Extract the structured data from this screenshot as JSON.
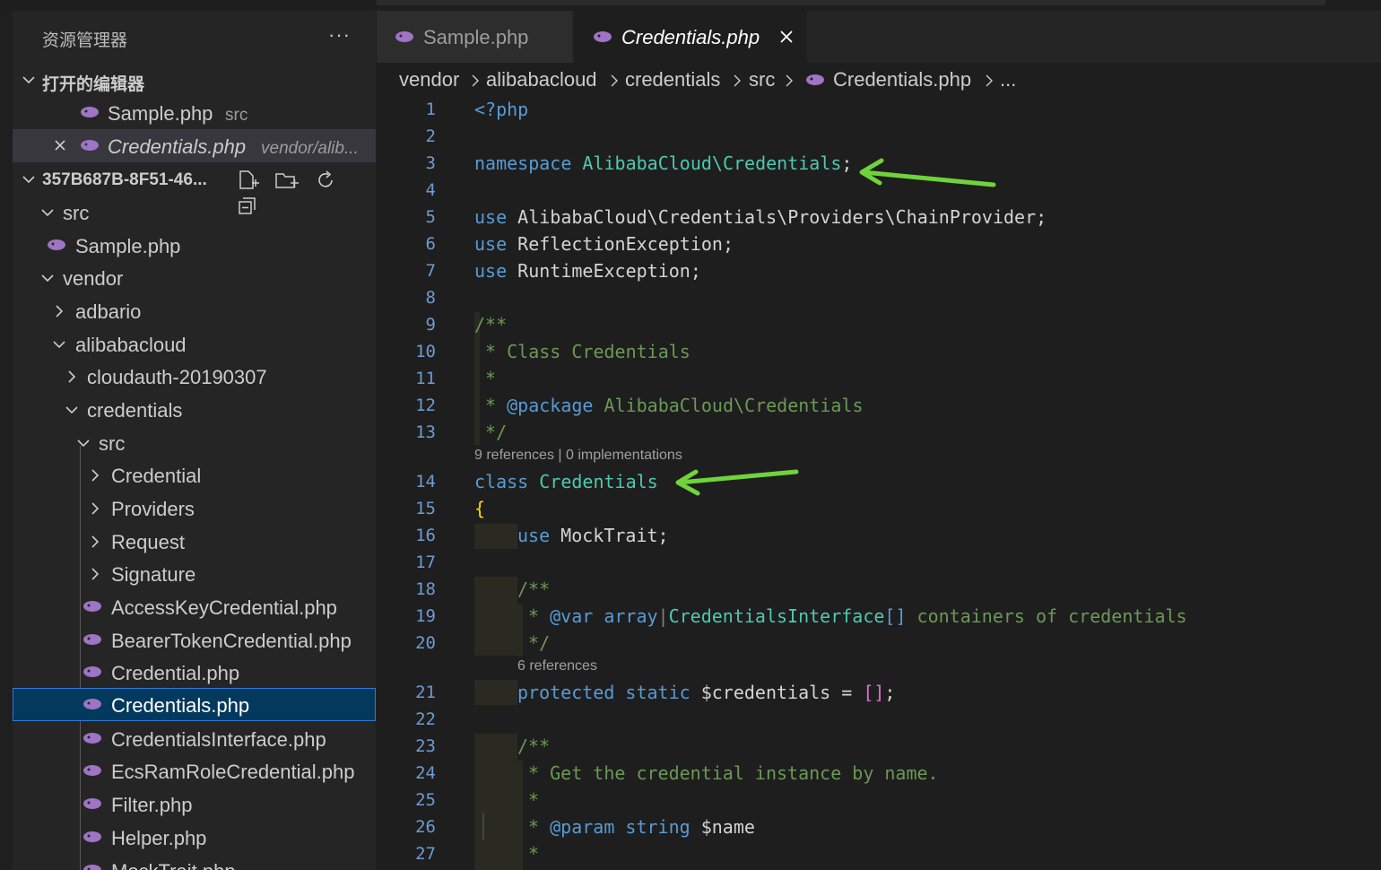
{
  "colors": {
    "accent": "#04395e",
    "php_icon": "#a074c4",
    "arrow": "#6fd33a"
  },
  "sidebar": {
    "title": "资源管理器",
    "more": "···",
    "open_editors": {
      "label": "打开的编辑器",
      "items": [
        {
          "name": "Sample.php",
          "desc": "src"
        },
        {
          "name": "Credentials.php",
          "desc": "vendor/alib..."
        }
      ]
    },
    "workspace": {
      "label": "357B687B-8F51-46...",
      "tree": [
        {
          "name": "src"
        },
        {
          "name": "Sample.php"
        },
        {
          "name": "vendor"
        },
        {
          "name": "adbario"
        },
        {
          "name": "alibabacloud"
        },
        {
          "name": "cloudauth-20190307"
        },
        {
          "name": "credentials"
        },
        {
          "name": "src"
        },
        {
          "name": "Credential"
        },
        {
          "name": "Providers"
        },
        {
          "name": "Request"
        },
        {
          "name": "Signature"
        },
        {
          "name": "AccessKeyCredential.php"
        },
        {
          "name": "BearerTokenCredential.php"
        },
        {
          "name": "Credential.php"
        },
        {
          "name": "Credentials.php"
        },
        {
          "name": "CredentialsInterface.php"
        },
        {
          "name": "EcsRamRoleCredential.php"
        },
        {
          "name": "Filter.php"
        },
        {
          "name": "Helper.php"
        },
        {
          "name": "MockTrait.php"
        }
      ]
    }
  },
  "tabs": [
    {
      "label": "Sample.php"
    },
    {
      "label": "Credentials.php",
      "close": "×"
    }
  ],
  "breadcrumb": [
    "vendor",
    "alibabacloud",
    "credentials",
    "src",
    "Credentials.php",
    "..."
  ],
  "editor": {
    "line_numbers": [
      "1",
      "2",
      "3",
      "4",
      "5",
      "6",
      "7",
      "8",
      "9",
      "10",
      "11",
      "12",
      "13",
      "14",
      "15",
      "16",
      "17",
      "18",
      "19",
      "20",
      "21",
      "22",
      "23",
      "24",
      "25",
      "26",
      "27"
    ],
    "code": {
      "l1": "<?php",
      "l3_kw": "namespace",
      "l3_ns": "AlibabaCloud\\Credentials",
      "l3_end": ";",
      "l5_kw": "use",
      "l5_rest": "AlibabaCloud\\Credentials\\Providers\\ChainProvider;",
      "l6_kw": "use",
      "l6_rest": "ReflectionException;",
      "l7_kw": "use",
      "l7_rest": "RuntimeException;",
      "l9": "/**",
      "l10": " * Class Credentials",
      "l11": " *",
      "l12_a": " * ",
      "l12_tag": "@package",
      "l12_b": " AlibabaCloud\\Credentials",
      "l13": " */",
      "lens1": "9 references | 0 implementations",
      "l14_kw": "class",
      "l14_cls": "Credentials",
      "l15": "{",
      "l16_kw": "use",
      "l16_rest": "MockTrait;",
      "l18": "/**",
      "l19_a": " * ",
      "l19_tag": "@var",
      "l19_type": " array",
      "l19_bar": "|",
      "l19_ns": "CredentialsInterface",
      "l19_br": "[]",
      "l19_b": " containers of credentials",
      "l20": " */",
      "lens2": "6 references",
      "l21_kw": "protected static",
      "l21_var": " $credentials = ",
      "l21_br": "[]",
      "l21_end": ";",
      "l23": "/**",
      "l24": " * Get the credential instance by name.",
      "l25": " *",
      "l26_a": " * ",
      "l26_tag": "@param",
      "l26_type": " string",
      "l26_var": " $name",
      "l27": " *"
    }
  }
}
